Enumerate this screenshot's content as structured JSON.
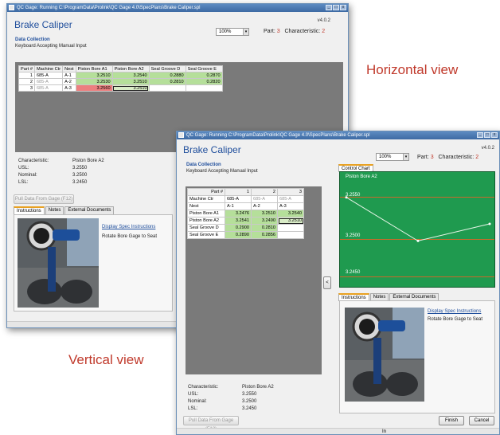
{
  "window_title": "QC Gage: Running C:\\ProgramData\\Prolink\\QC Gage 4.0\\SpecPlans\\Brake Caliper.spl",
  "app_title": "Brake Caliper",
  "version": "v4.0.2",
  "zoom": "100%",
  "part_label": "Part:",
  "part_value": "3",
  "char_label": "Characteristic:",
  "char_value": "2",
  "data_collection": "Data Collection",
  "input_mode": "Keyboard Accepting Manual Input",
  "horizontal": {
    "headers": [
      "Part #",
      "Machine Ctr",
      "Nest",
      "Piston Bore A1",
      "Piston Bore A2",
      "Seal Groove D",
      "Seal Groove E"
    ],
    "rows": [
      {
        "part": "1",
        "machine": "685-A",
        "nest": "A-1",
        "a1": "3.2510",
        "a2": "3.2540",
        "d": "0.2880",
        "e": "0.2870"
      },
      {
        "part": "2",
        "machine": "685-A",
        "nest": "A-2",
        "a1": "3.2530",
        "a2": "3.2510",
        "d": "0.2810",
        "e": "0.2820"
      },
      {
        "part": "3",
        "machine": "685-A",
        "nest": "A-3",
        "a1": "3.2560",
        "a2": "3.2510",
        "d": "",
        "e": ""
      }
    ]
  },
  "vertical": {
    "part_label": "Part #",
    "cols": [
      "1",
      "2",
      "3"
    ],
    "rows": [
      {
        "label": "Machine Ctr",
        "v": [
          "685-A",
          "685-A",
          "685-A"
        ]
      },
      {
        "label": "Nest",
        "v": [
          "A-1",
          "A-2",
          "A-3"
        ]
      },
      {
        "label": "Piston Bore A1",
        "v": [
          "3.2476",
          "3.2510",
          "3.2540"
        ]
      },
      {
        "label": "Piston Bore A2",
        "v": [
          "3.2541",
          "3.2490",
          "3.2510"
        ]
      },
      {
        "label": "Seal Groove D",
        "v": [
          "0.2900",
          "0.2810",
          ""
        ]
      },
      {
        "label": "Seal Groove E",
        "v": [
          "0.2890",
          "0.2856",
          ""
        ]
      }
    ]
  },
  "spec": {
    "char_label": "Characteristic:",
    "char_value": "Piston Bore A2",
    "usl_label": "USL:",
    "usl": "3.2550",
    "nominal_label": "Nominal:",
    "nominal": "3.2500",
    "lsl_label": "LSL:",
    "lsl": "3.2450"
  },
  "pull_button": "Pull Data From Gage (F12)",
  "tabs": [
    "Instructions",
    "Notes",
    "External Documents"
  ],
  "display_spec_link": "Display Spec Instructions",
  "instruction_text": "Rotate Bore Gage to Seat",
  "control_chart_tab": "Control Chart",
  "chart_data": {
    "type": "line",
    "title": "Piston Bore A2",
    "x": [
      1,
      2,
      3
    ],
    "values": [
      3.2541,
      3.249,
      3.251
    ],
    "ylabels": [
      "3.2550",
      "3.2500",
      "3.2450"
    ],
    "ylim": [
      3.244,
      3.2565
    ]
  },
  "collapse_button": "<",
  "finish_button": "Finish",
  "cancel_button": "Cancel",
  "status_text": "In",
  "callout_horizontal": "Horizontal view",
  "callout_vertical": "Vertical view",
  "colors": {
    "title_blue": "#1f4e9c",
    "accent_red": "#c0392b",
    "chart_green": "#1f9a4f",
    "cell_green": "#b5df9a",
    "cell_red": "#ec7f7f"
  }
}
